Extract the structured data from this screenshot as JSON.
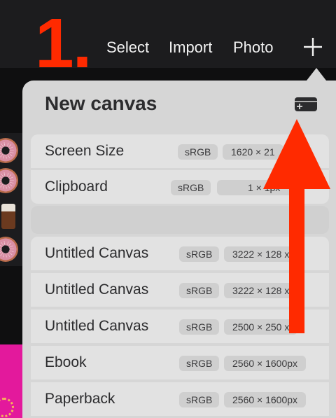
{
  "toolbar": {
    "select_label": "Select",
    "import_label": "Import",
    "photo_label": "Photo",
    "plus_icon": "plus-icon"
  },
  "annotation": {
    "step_number": "1.",
    "accent_color": "#ff2a00"
  },
  "panel": {
    "title": "New canvas",
    "add_preset_icon": "new-canvas-preset-icon",
    "rows": [
      {
        "name": "Screen Size",
        "profile": "sRGB",
        "size": "1620 × 21"
      },
      {
        "name": "Clipboard",
        "profile": "sRGB",
        "size": "1 × 1px"
      },
      {
        "name": "Untitled Canvas",
        "profile": "sRGB",
        "size": "3222 × 128  x"
      },
      {
        "name": "Untitled Canvas",
        "profile": "sRGB",
        "size": "3222 × 128  x"
      },
      {
        "name": "Untitled Canvas",
        "profile": "sRGB",
        "size": "2500 × 250  x"
      },
      {
        "name": "Ebook",
        "profile": "sRGB",
        "size": "2560 × 1600px"
      },
      {
        "name": "Paperback",
        "profile": "sRGB",
        "size": "2560 × 1600px"
      }
    ]
  }
}
